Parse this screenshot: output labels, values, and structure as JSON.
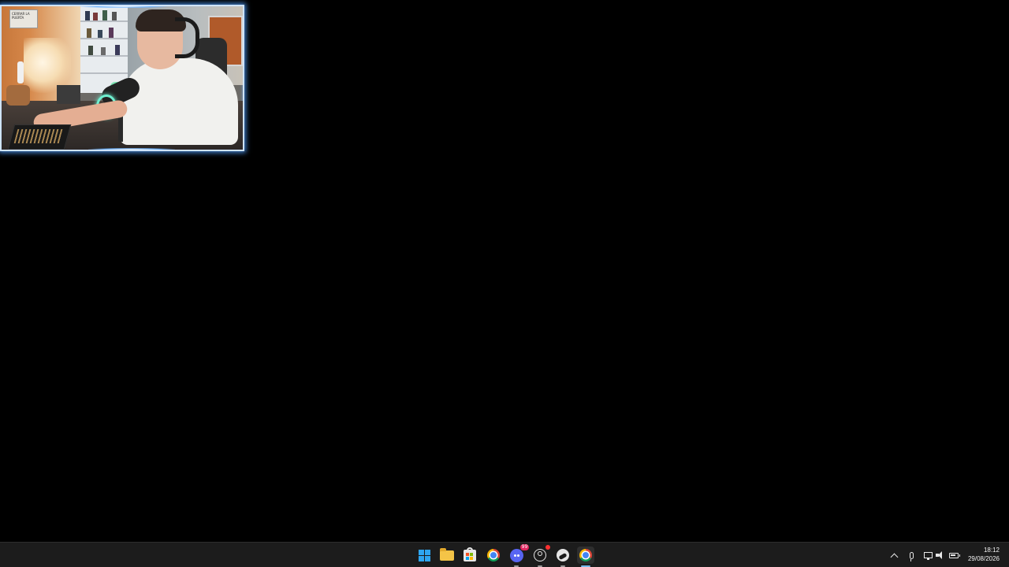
{
  "webcam": {
    "poster_text": "CERRAR LA PUERTA"
  },
  "taskbar": {
    "apps": [
      {
        "name": "start",
        "icon": "windows-start-icon"
      },
      {
        "name": "file-explorer",
        "icon": "folder-icon"
      },
      {
        "name": "microsoft-store",
        "icon": "store-icon"
      },
      {
        "name": "chrome",
        "icon": "chrome-icon"
      },
      {
        "name": "discord",
        "icon": "discord-icon",
        "badge": "99"
      },
      {
        "name": "obs",
        "icon": "obs-icon"
      },
      {
        "name": "steam",
        "icon": "steam-icon"
      },
      {
        "name": "chrome-active",
        "icon": "chrome-icon"
      }
    ],
    "tray": {
      "icons": [
        "chevron-up-icon",
        "microphone-icon",
        "display-icon",
        "speaker-icon",
        "battery-icon"
      ]
    },
    "clock": {
      "time": "18:12",
      "date": "29/08/2026"
    }
  },
  "colors": {
    "desktop_bg": "#000000",
    "taskbar_bg": "#1c1c1c",
    "webcam_border": "#cfe4ff",
    "accent": "#2ea6f2"
  }
}
